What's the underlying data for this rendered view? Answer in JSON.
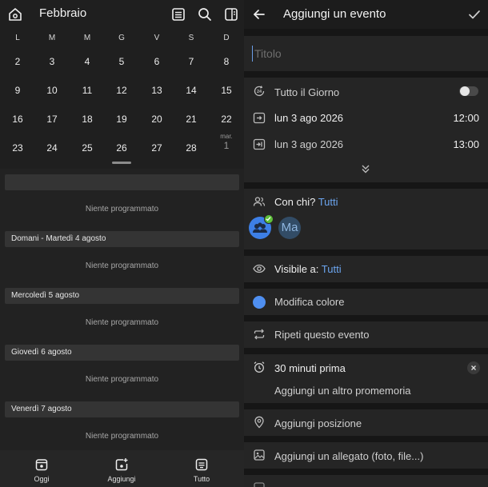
{
  "calendar": {
    "month_title": "Febbraio",
    "weekdays": [
      "L",
      "M",
      "M",
      "G",
      "V",
      "S",
      "D"
    ],
    "weeks": [
      [
        "2",
        "3",
        "4",
        "5",
        "6",
        "7",
        "8"
      ],
      [
        "9",
        "10",
        "11",
        "12",
        "13",
        "14",
        "15"
      ],
      [
        "16",
        "17",
        "18",
        "19",
        "20",
        "21",
        "22"
      ],
      [
        "23",
        "24",
        "25",
        "26",
        "27",
        "28",
        ""
      ]
    ],
    "overflow_day": {
      "label": "mar.",
      "number": "1"
    }
  },
  "agenda": {
    "empty_text": "Niente programmato",
    "days": [
      {
        "header": ""
      },
      {
        "header": "Domani - Martedì 4 agosto"
      },
      {
        "header": "Mercoledì 5 agosto"
      },
      {
        "header": "Giovedì 6 agosto"
      },
      {
        "header": "Venerdì 7 agosto"
      }
    ]
  },
  "bottom_nav": {
    "today": "Oggi",
    "add": "Aggiungi",
    "all": "Tutto"
  },
  "event_form": {
    "title": "Aggiungi un evento",
    "title_placeholder": "Titolo",
    "all_day_label": "Tutto il Giorno",
    "all_day_on": false,
    "start_date": "lun 3 ago 2026",
    "start_time": "12:00",
    "end_date": "lun 3 ago 2026",
    "end_time": "13:00",
    "with_label": "Con chi?",
    "with_value": "Tutti",
    "participant_initials": "Ma",
    "visible_label": "Visibile a:",
    "visible_value": "Tutti",
    "color_label": "Modifica colore",
    "repeat_label": "Ripeti questo evento",
    "reminder_label": "30 minuti prima",
    "add_reminder_label": "Aggiungi un altro promemoria",
    "location_label": "Aggiungi posizione",
    "attachment_label": "Aggiungi un allegato (foto, file...)",
    "colors": {
      "accent": "#6ba4ee",
      "event_color": "#4f8ff0",
      "check": "#5fbf3a"
    }
  }
}
